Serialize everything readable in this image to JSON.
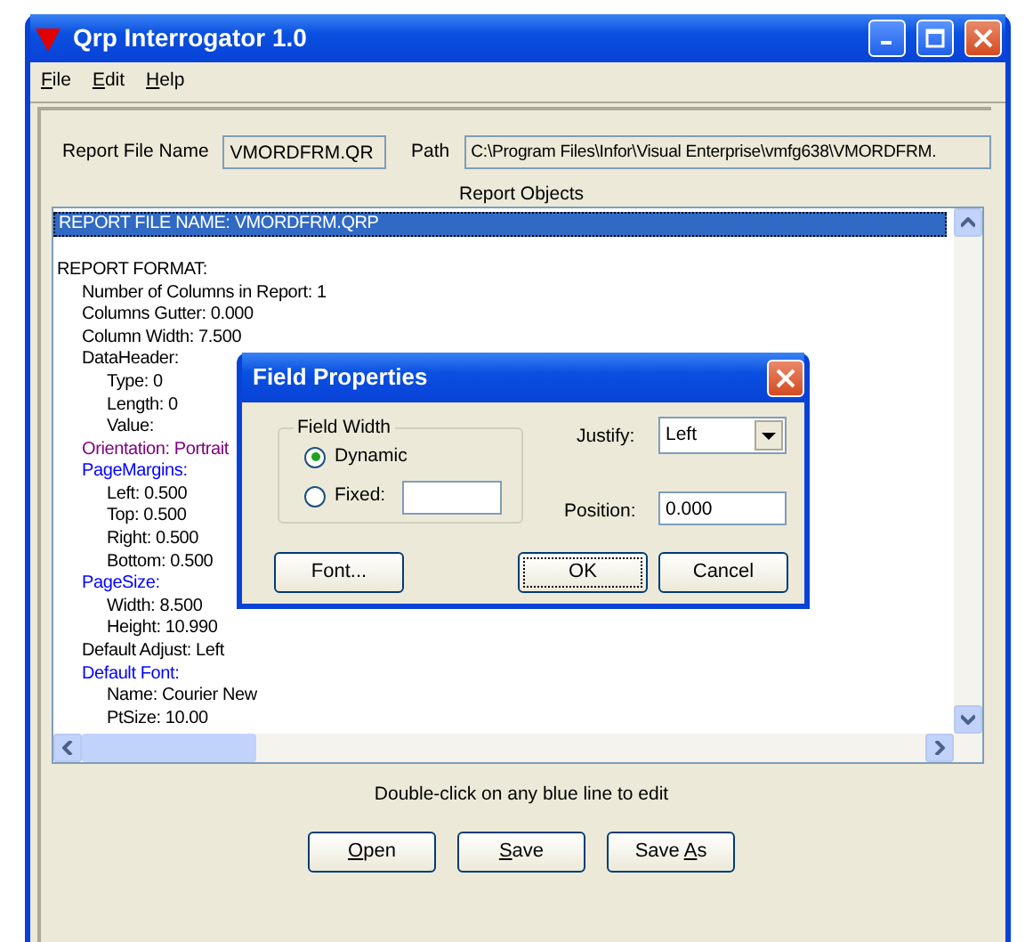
{
  "window": {
    "title": "Qrp Interrogator 1.0"
  },
  "menu": [
    {
      "key": "F",
      "post": "ile"
    },
    {
      "key": "E",
      "post": "dit"
    },
    {
      "key": "H",
      "post": "elp"
    }
  ],
  "report_file_name": {
    "label": "Report File Name",
    "value": "VMORDFRM.QR"
  },
  "path": {
    "label": "Path",
    "value": "C:\\Program Files\\Infor\\Visual Enterprise\\vmfg638\\VMORDFRM."
  },
  "report_objects": {
    "label": "Report Objects",
    "lines": [
      {
        "text": "REPORT FILE NAME: VMORDFRM.QRP",
        "selected": true
      },
      {
        "text": "REPORT FORMAT:",
        "color": "#000000",
        "selected": false,
        "children": [
          {
            "text": "Number of Columns in Report: 1",
            "color": "#000000",
            "selected": false
          },
          {
            "text": "Columns Gutter: 0.000",
            "color": "#000000",
            "selected": false
          },
          {
            "text": "Column Width: 7.500",
            "color": "#000000",
            "selected": false
          },
          {
            "text": "DataHeader:",
            "color": "#000000",
            "selected": false,
            "children": [
              {
                "text": "Type: 0",
                "color": "#000000",
                "selected": false
              },
              {
                "text": "Length: 0",
                "color": "#000000",
                "selected": false
              },
              {
                "text": "Value:",
                "color": "#000000",
                "selected": false
              }
            ]
          },
          {
            "text": "Orientation: Portrait",
            "color": "#800080",
            "selected": false
          },
          {
            "text": "PageMargins:",
            "color": "#0000ff",
            "selected": false,
            "children": [
              {
                "text": "Left: 0.500",
                "color": "#000000",
                "selected": false
              },
              {
                "text": "Top: 0.500",
                "color": "#000000",
                "selected": false
              },
              {
                "text": "Right: 0.500",
                "color": "#000000",
                "selected": false
              },
              {
                "text": "Bottom: 0.500",
                "color": "#000000",
                "selected": false
              }
            ]
          },
          {
            "text": "PageSize:",
            "color": "#0000ff",
            "selected": false,
            "children": [
              {
                "text": "Width: 8.500",
                "color": "#000000",
                "selected": false
              },
              {
                "text": "Height: 10.990",
                "color": "#000000",
                "selected": false
              }
            ]
          },
          {
            "text": "Default Adjust: Left",
            "color": "#000000",
            "selected": false
          },
          {
            "text": "Default Font:",
            "color": "#0000ff",
            "selected": false,
            "children": [
              {
                "text": "Name: Courier New",
                "color": "#000000",
                "selected": false
              },
              {
                "text": "PtSize: 10.00",
                "color": "#000000",
                "selected": false
              }
            ]
          }
        ]
      }
    ]
  },
  "hint": "Double-click on any blue line to edit",
  "buttons": [
    {
      "key": "O",
      "post": "pen"
    },
    {
      "key": "S",
      "post": "ave"
    },
    {
      "pre": "Save ",
      "key": "A",
      "post": "s"
    }
  ],
  "dialog": {
    "title": "Field Properties",
    "field_width": {
      "legend": "Field Width",
      "options": [
        {
          "label": "Dynamic",
          "selected": true
        },
        {
          "label": "Fixed:",
          "selected": false
        }
      ]
    },
    "justify": {
      "label": "Justify:",
      "value": "Left"
    },
    "position": {
      "label": "Position:",
      "value": "0.000"
    },
    "buttons": [
      {
        "label": "Font...",
        "focused": false
      },
      {
        "label": "OK",
        "focused": true
      },
      {
        "label": "Cancel",
        "focused": false
      }
    ]
  }
}
